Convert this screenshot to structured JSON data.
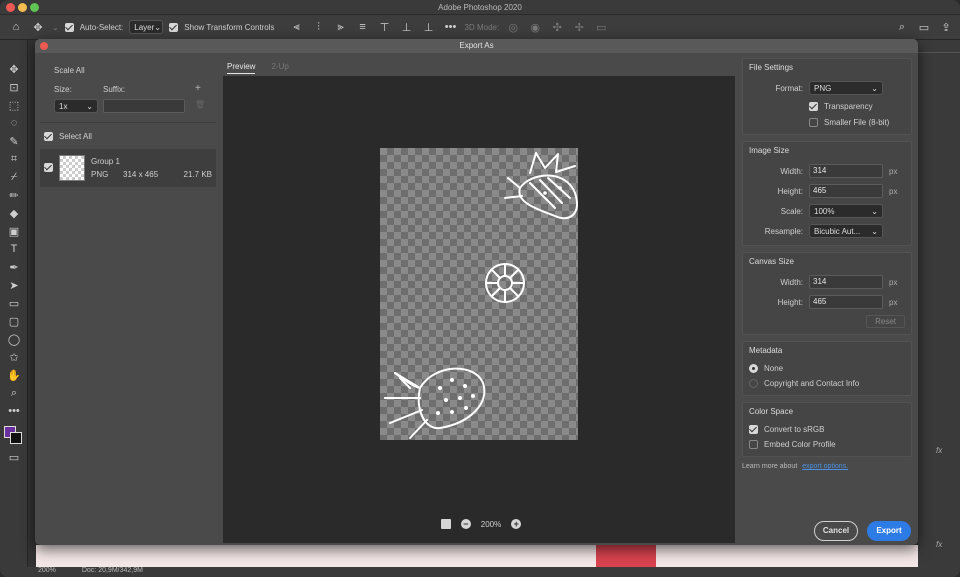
{
  "app": {
    "title": "Adobe Photoshop 2020"
  },
  "options_bar": {
    "auto_select_label": "Auto-Select:",
    "auto_select_target": "Layer",
    "show_transform_label": "Show Transform Controls",
    "mode_3d_label": "3D Mode:"
  },
  "dialog": {
    "title": "Export As",
    "scale_all": {
      "heading": "Scale All",
      "size_label": "Size:",
      "suffix_label": "Suffix:",
      "size_value": "1x",
      "add_symbol": "+"
    },
    "select_all_label": "Select All",
    "layer": {
      "name": "Group 1",
      "format": "PNG",
      "dimensions": "314 x 465",
      "file_size": "21.7 KB"
    },
    "tabs": [
      {
        "label": "Preview"
      },
      {
        "label": "2-Up"
      }
    ],
    "zoom_value": "200%",
    "file_settings": {
      "heading": "File Settings",
      "format_label": "Format:",
      "format_value": "PNG",
      "transparency_label": "Transparency",
      "smaller_file_label": "Smaller File (8-bit)"
    },
    "image_size": {
      "heading": "Image Size",
      "width_label": "Width:",
      "width_value": "314",
      "height_label": "Height:",
      "height_value": "465",
      "scale_label": "Scale:",
      "scale_value": "100%",
      "resample_label": "Resample:",
      "resample_value": "Bicubic Aut...",
      "unit": "px"
    },
    "canvas_size": {
      "heading": "Canvas Size",
      "width_label": "Width:",
      "width_value": "314",
      "height_label": "Height:",
      "height_value": "465",
      "unit": "px",
      "reset_label": "Reset"
    },
    "metadata": {
      "heading": "Metadata",
      "none_label": "None",
      "copyright_label": "Copyright and Contact Info"
    },
    "color_space": {
      "heading": "Color Space",
      "convert_label": "Convert to sRGB",
      "embed_label": "Embed Color Profile"
    },
    "learn_more_text": "Learn more about",
    "learn_more_link": "export options.",
    "cancel_label": "Cancel",
    "export_label": "Export"
  },
  "status_bar": {
    "zoom": "200%",
    "doc_info": "Doc: 20,9M/342,9M"
  },
  "colors": {
    "accent": "#2d7be5",
    "foreground_swatch": "#6b2fa0"
  }
}
